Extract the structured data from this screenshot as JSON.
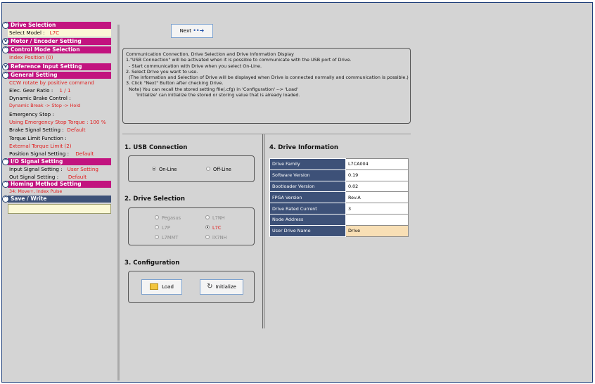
{
  "sidebar": {
    "drive_selection": {
      "title": "Drive Selection",
      "select_model_label": "Select Model :",
      "select_model_value": "L7C"
    },
    "motor_encoder": {
      "title": "Motor / Encoder Setting"
    },
    "control_mode": {
      "title": "Control Mode Selection",
      "value": "Index Position (0)"
    },
    "reference_input": {
      "title": "Reference Input Setting"
    },
    "general": {
      "title": "General Setting",
      "rotate": "CCW rotate by positive command",
      "gear_label": "Elec. Gear Ratio :",
      "gear_value": "1 / 1",
      "brake_ctrl_label": "Dynamic Brake Control :",
      "brake_ctrl_value": "Dynamic Break -> Stop -> Hold",
      "estop_label": "Emergency Stop :",
      "estop_value": "Using Emergency Stop Torque : 100 %",
      "brake_sig_label": "Brake Signal Setting :",
      "brake_sig_value": "Default",
      "torque_limit_label": "Torque Limit Function :",
      "torque_limit_value": "External Torque Limit (2)",
      "position_sig_label": "Position Signal Setting :",
      "position_sig_value": "Default"
    },
    "io_signal": {
      "title": "I/O Signal Setting",
      "input_label": "Input Signal Setting :",
      "input_value": "User Setting",
      "output_label": "Out Signal Setting :",
      "output_value": "Default"
    },
    "homing": {
      "title": "Homing Method Setting",
      "value": "34: Move+, Index Pulse"
    },
    "save": {
      "title": "Save / Write"
    }
  },
  "main": {
    "next_label": "Next",
    "info_lines": [
      "Communication Connection, Drive Selection and Drive Information Display",
      "",
      "1.\"USB Connection\" will be activated when it is possible to communicate with the USB port of Drive.",
      "  - Start communication with Drive when you select On-Line.",
      "",
      "2. Select Drive you want to use.",
      "  (The information and Selection of Drive will be displayed when Drive is connected normally and communication is possible.)",
      "",
      "3. Click \"Next\" Button after checking Drive.",
      "  Note) You can recall the stored setting file(.cfg) in 'Configuration' --> 'Load'",
      "       'Initialize' can initialize the stored or storing value that is already loaded."
    ],
    "usb": {
      "title": "1. USB Connection",
      "online": "On-Line",
      "offline": "Off-Line"
    },
    "drive_selection": {
      "title": "2. Drive Selection",
      "options": [
        "Pegasus",
        "L7NH",
        "L7P",
        "L7C",
        "L7MMT",
        "iX7NH"
      ],
      "selected": "L7C"
    },
    "configuration": {
      "title": "3. Configuration",
      "load": "Load",
      "initialize": "Initialize"
    },
    "drive_info": {
      "title": "4. Drive Information",
      "rows": [
        {
          "label": "Drive Family",
          "value": "L7CA004"
        },
        {
          "label": "Software Version",
          "value": "0.19"
        },
        {
          "label": "Bootloader Version",
          "value": "0.02"
        },
        {
          "label": "FPGA Version",
          "value": "Rev.A"
        },
        {
          "label": "Drive Rated Current",
          "value": "3"
        },
        {
          "label": "Node Address",
          "value": ""
        },
        {
          "label": "User Drive Name",
          "value": "Drive"
        }
      ]
    }
  }
}
